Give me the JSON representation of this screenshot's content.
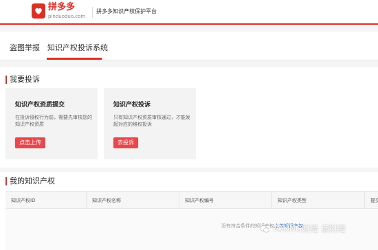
{
  "header": {
    "logo_text": "拼多多",
    "logo_url": "pinduoduo.com",
    "platform_name": "拼多多知识产权保护平台"
  },
  "tabs": [
    {
      "label": "盗图举报"
    },
    {
      "label": "知识产权投诉系统",
      "active": true
    }
  ],
  "sections": {
    "complaint_title": "我要投诉",
    "ip_title": "我的知识产权"
  },
  "cards": [
    {
      "title": "知识产权资质提交",
      "desc": "在投诉侵权行为前，需要先审核您的知识产权资质",
      "button": "点击上传"
    },
    {
      "title": "知识产权投诉",
      "desc": "只有知识产权资质审核通过，才能发起对应的维权投诉",
      "button": "去投诉"
    }
  ],
  "table": {
    "columns": [
      "知识产权ID",
      "知识产权名称",
      "知识产权编号",
      "知识产权类型",
      "提交"
    ],
    "empty_text": "没有符合条件的知识产权",
    "empty_link": "上传知识产权"
  },
  "watermark": "YOUNG财经 漾财经",
  "colors": {
    "brand": "#e02e24",
    "button": "#e8474b",
    "link": "#3f74c9"
  }
}
